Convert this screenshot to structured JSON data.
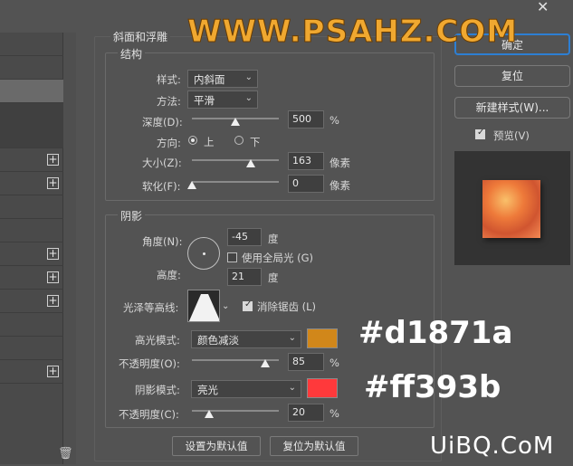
{
  "watermark_top": "WWW.PSAHZ.COM",
  "watermark_bottom": "UiBQ.CoM",
  "close_glyph": "✕",
  "bevel_section": {
    "title": "斜面和浮雕",
    "structure": {
      "title": "结构",
      "style_label": "样式:",
      "style_value": "内斜面",
      "technique_label": "方法:",
      "technique_value": "平滑",
      "depth_label": "深度(D):",
      "depth_value": "500",
      "depth_unit": "%",
      "depth_fraction": 0.5,
      "direction_label": "方向:",
      "direction_up": "上",
      "direction_down": "下",
      "direction_selected": "上",
      "size_label": "大小(Z):",
      "size_value": "163",
      "size_unit": "像素",
      "size_fraction": 0.66,
      "soften_label": "软化(F):",
      "soften_value": "0",
      "soften_unit": "像素",
      "soften_fraction": 0.0
    },
    "shading": {
      "title": "阴影",
      "angle_label": "角度(N):",
      "angle_value": "-45",
      "angle_unit": "度",
      "global_light_label": "使用全局光 (G)",
      "global_light_checked": false,
      "altitude_label": "高度:",
      "altitude_value": "21",
      "altitude_unit": "度",
      "gloss_contour_label": "光泽等高线:",
      "anti_alias_label": "消除锯齿 (L)",
      "anti_alias_checked": true,
      "highlight_mode_label": "高光模式:",
      "highlight_mode_value": "颜色减淡",
      "highlight_color": "#d1871a",
      "highlight_opacity_label": "不透明度(O):",
      "highlight_opacity_value": "85",
      "highlight_opacity_unit": "%",
      "highlight_opacity_fraction": 0.85,
      "shadow_mode_label": "阴影模式:",
      "shadow_mode_value": "亮光",
      "shadow_color": "#ff393b",
      "shadow_opacity_label": "不透明度(C):",
      "shadow_opacity_value": "20",
      "shadow_opacity_unit": "%",
      "shadow_opacity_fraction": 0.2
    },
    "make_default_label": "设置为默认值",
    "reset_default_label": "复位为默认值"
  },
  "right_panel": {
    "ok_label": "确定",
    "reset_label": "复位",
    "new_style_label": "新建样式(W)...",
    "preview_label": "预览(V)",
    "preview_checked": true
  },
  "overlay_labels": {
    "highlight_hex": "#d1871a",
    "shadow_hex": "#ff393b"
  }
}
